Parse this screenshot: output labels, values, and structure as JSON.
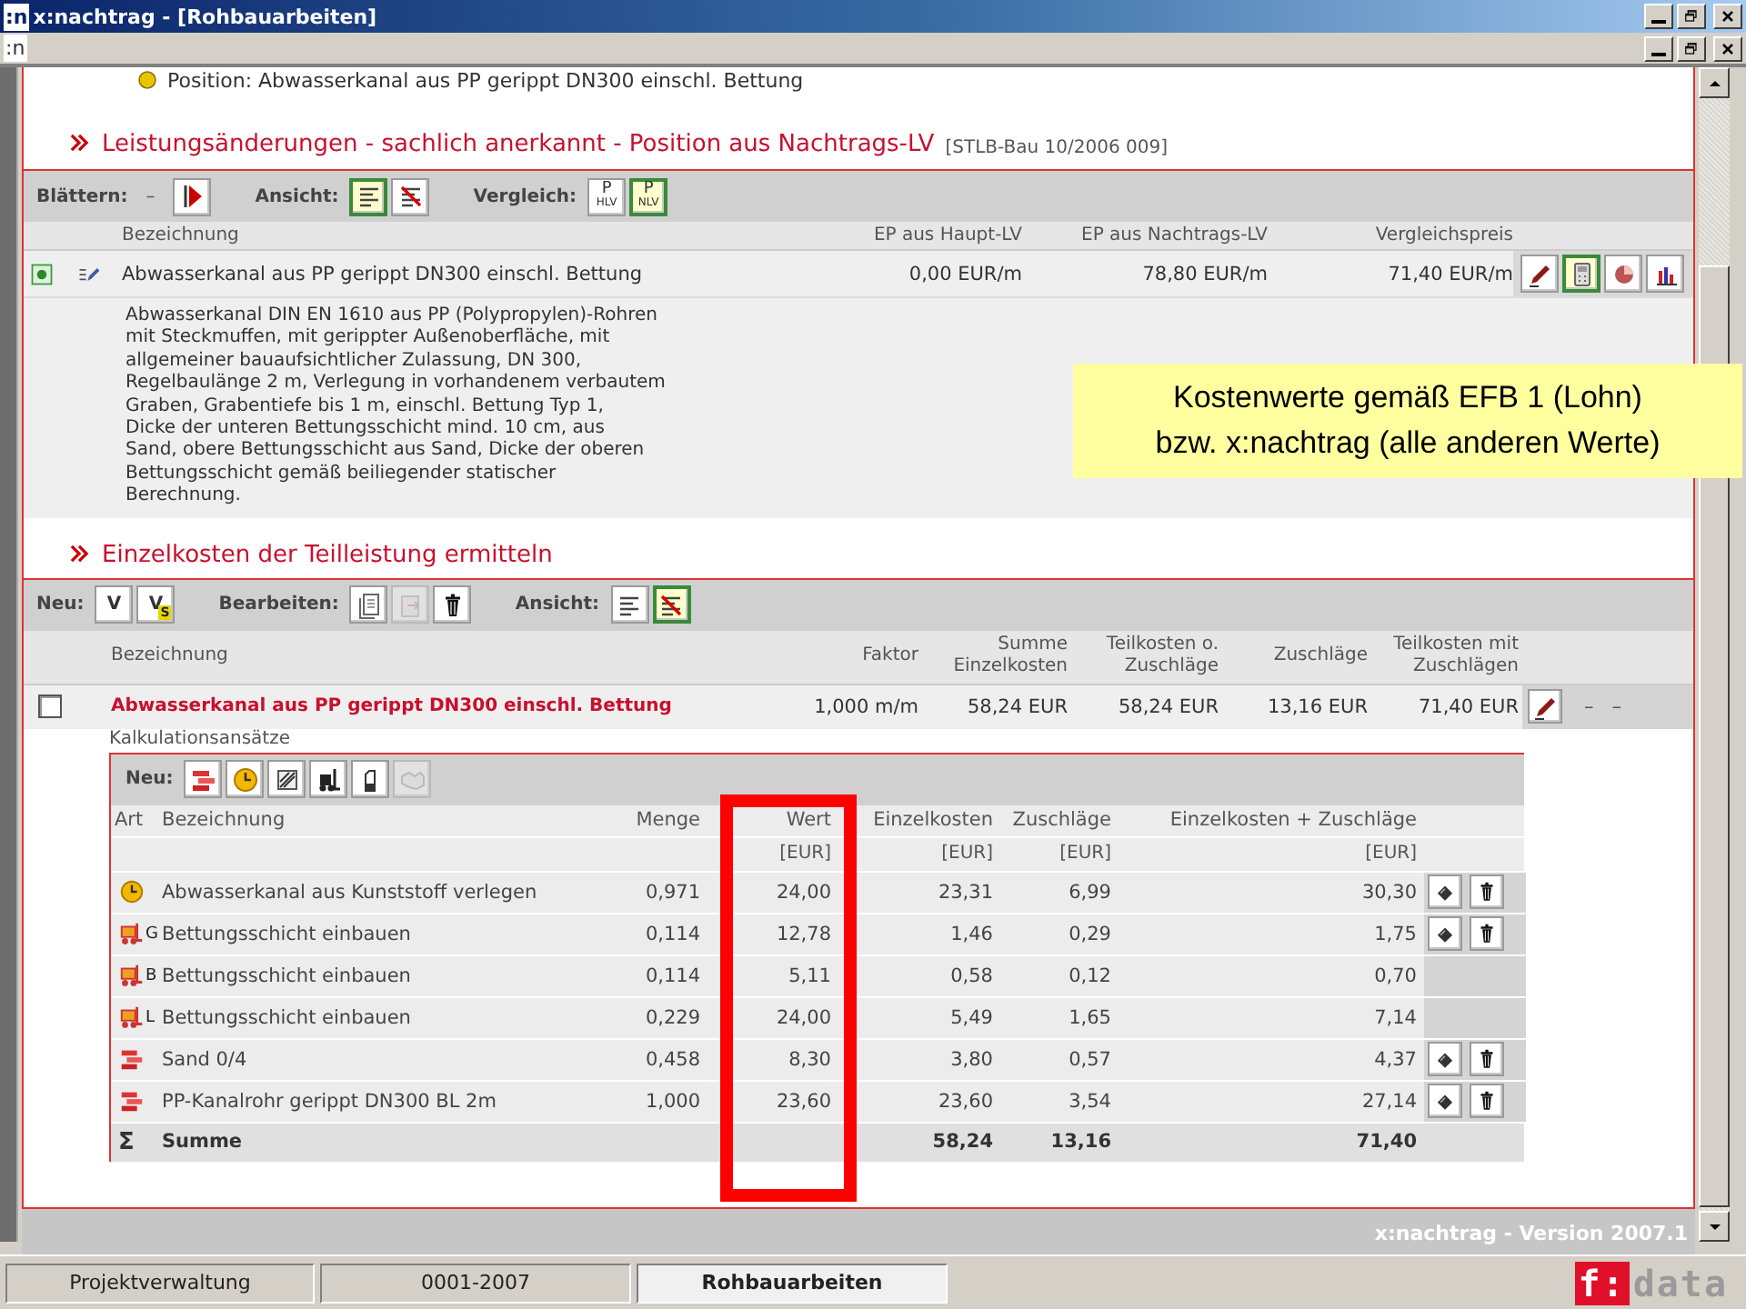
{
  "window": {
    "icon": ":n",
    "title": "x:nachtrag - [Rohbauarbeiten]"
  },
  "menu_bar": {
    "icon": ":n"
  },
  "position_line": "Position: Abwasserkanal aus PP gerippt DN300 einschl. Bettung",
  "section_changes": {
    "title": "Leistungsänderungen - sachlich anerkannt - Position aus Nachtrags-LV",
    "reference": "[STLB-Bau 10/2006 009]",
    "toolbar": {
      "browse_label": "Blättern:",
      "browse_previous": "–",
      "view_label": "Ansicht:",
      "views": [
        {
          "kind": "lines",
          "selected": true
        },
        {
          "kind": "crossed",
          "selected": false
        }
      ],
      "compare_label": "Vergleich:",
      "compare": [
        {
          "letter": "P",
          "code": "HLV",
          "selected": false
        },
        {
          "letter": "P",
          "code": "NLV",
          "selected": true
        }
      ]
    },
    "columns": [
      "Bezeichnung",
      "EP aus Haupt-LV",
      "EP aus Nachtrags-LV",
      "Vergleichspreis"
    ],
    "position": {
      "name": "Abwasserkanal aus PP gerippt DN300 einschl. Bettung",
      "ep_main": "0,00 EUR/m",
      "ep_supplement": "78,80 EUR/m",
      "comparison_price": "71,40 EUR/m",
      "actions": [
        {
          "kind": "pencil",
          "selected": false
        },
        {
          "kind": "calculator",
          "selected": true
        },
        {
          "kind": "pie",
          "selected": false
        },
        {
          "kind": "bars",
          "selected": false
        }
      ],
      "description_lines": [
        "Abwasserkanal DIN EN 1610 aus PP (Polypropylen)-Rohren",
        "mit Steckmuffen, mit gerippter Außenoberfläche, mit",
        "allgemeiner bauaufsichtlicher Zulassung, DN 300,",
        "Regelbaulänge 2 m, Verlegung in vorhandenem verbautem",
        "Graben, Grabentiefe bis 1 m, einschl. Bettung Typ 1,",
        "Dicke der unteren Bettungsschicht mind. 10 cm, aus",
        "Sand, obere Bettungsschicht aus Sand, Dicke der oberen",
        "Bettungsschicht gemäß beiliegender statischer",
        "Berechnung."
      ]
    }
  },
  "callout": {
    "lines": [
      "Kostenwerte gemäß EFB 1 (Lohn)",
      "bzw. x:nachtrag (alle anderen Werte)"
    ]
  },
  "section_costs": {
    "title": "Einzelkosten der Teilleistung ermitteln",
    "toolbar": {
      "new_label": "Neu:",
      "new_buttons": [
        {
          "letter": "V"
        },
        {
          "letter": "V",
          "badge": "S"
        }
      ],
      "edit_label": "Bearbeiten:",
      "edit_buttons": [
        {
          "kind": "document",
          "disabled": false
        },
        {
          "kind": "paste",
          "disabled": true
        },
        {
          "kind": "trash",
          "disabled": false
        }
      ],
      "view_label": "Ansicht:",
      "views": [
        {
          "kind": "lines",
          "selected": false
        },
        {
          "kind": "crossed",
          "selected": true
        }
      ]
    },
    "columns": [
      [
        "Bezeichnung"
      ],
      [
        "Faktor"
      ],
      [
        "Summe",
        "Einzelkosten"
      ],
      [
        "Teilkosten o.",
        "Zuschläge"
      ],
      [
        "Zuschläge"
      ],
      [
        "Teilkosten mit",
        "Zuschlägen"
      ]
    ],
    "item": {
      "checked": false,
      "name": "Abwasserkanal aus PP gerippt DN300 einschl. Bettung",
      "factor": "1,000 m/m",
      "sum_direct": "58,24 EUR",
      "partial": "58,24 EUR",
      "surcharges": "13,16 EUR",
      "partial_with": "71,40 EUR",
      "placeholders": [
        "–",
        "–"
      ]
    },
    "calc_label": "Kalkulationsansätze",
    "calc": {
      "new_label": "Neu:",
      "new_buttons": [
        {
          "kind": "bricks",
          "disabled": false
        },
        {
          "kind": "clock",
          "disabled": false
        },
        {
          "kind": "tools",
          "disabled": false
        },
        {
          "kind": "forklift",
          "disabled": false
        },
        {
          "kind": "glove",
          "disabled": false
        },
        {
          "kind": "handshake",
          "disabled": true
        }
      ],
      "columns": [
        "Art",
        "Bezeichnung",
        "Menge",
        "Wert",
        "Einzelkosten",
        "Zuschläge",
        "Einzelkosten + Zuschläge"
      ],
      "units": {
        "value": "[EUR]",
        "direct": "[EUR]",
        "surcharge": "[EUR]",
        "total": "[EUR]"
      },
      "rows": [
        {
          "kind": "wage",
          "name": "Abwasserkanal aus Kunststoff verlegen",
          "quantity": "0,971",
          "value": "24,00",
          "direct": "23,31",
          "surcharge": "6,99",
          "total": "30,30",
          "editable": true
        },
        {
          "kind": "device",
          "code": "G",
          "name": "Bettungsschicht einbauen",
          "quantity": "0,114",
          "value": "12,78",
          "direct": "1,46",
          "surcharge": "0,29",
          "total": "1,75",
          "editable": true
        },
        {
          "kind": "device",
          "code": "B",
          "name": "Bettungsschicht einbauen",
          "quantity": "0,114",
          "value": "5,11",
          "direct": "0,58",
          "surcharge": "0,12",
          "total": "0,70",
          "editable": false
        },
        {
          "kind": "device",
          "code": "L",
          "name": "Bettungsschicht einbauen",
          "quantity": "0,229",
          "value": "24,00",
          "direct": "5,49",
          "surcharge": "1,65",
          "total": "7,14",
          "editable": false
        },
        {
          "kind": "material",
          "name": "Sand 0/4",
          "quantity": "0,458",
          "value": "8,30",
          "direct": "3,80",
          "surcharge": "0,57",
          "total": "4,37",
          "editable": true
        },
        {
          "kind": "material",
          "name": "PP-Kanalrohr gerippt DN300 BL 2m",
          "quantity": "1,000",
          "value": "23,60",
          "direct": "23,60",
          "surcharge": "3,54",
          "total": "27,14",
          "editable": true
        }
      ],
      "total": {
        "symbol": "Σ",
        "label": "Summe",
        "direct": "58,24",
        "surcharge": "13,16",
        "total": "71,40"
      }
    }
  },
  "version": "x:nachtrag - Version 2007.1",
  "taskbar": {
    "tabs": [
      {
        "label": "Projektverwaltung",
        "selected": false
      },
      {
        "label": "0001-2007",
        "selected": false
      },
      {
        "label": "Rohbauarbeiten",
        "selected": true
      }
    ],
    "logo": {
      "mark": "f:",
      "name": "data"
    }
  }
}
